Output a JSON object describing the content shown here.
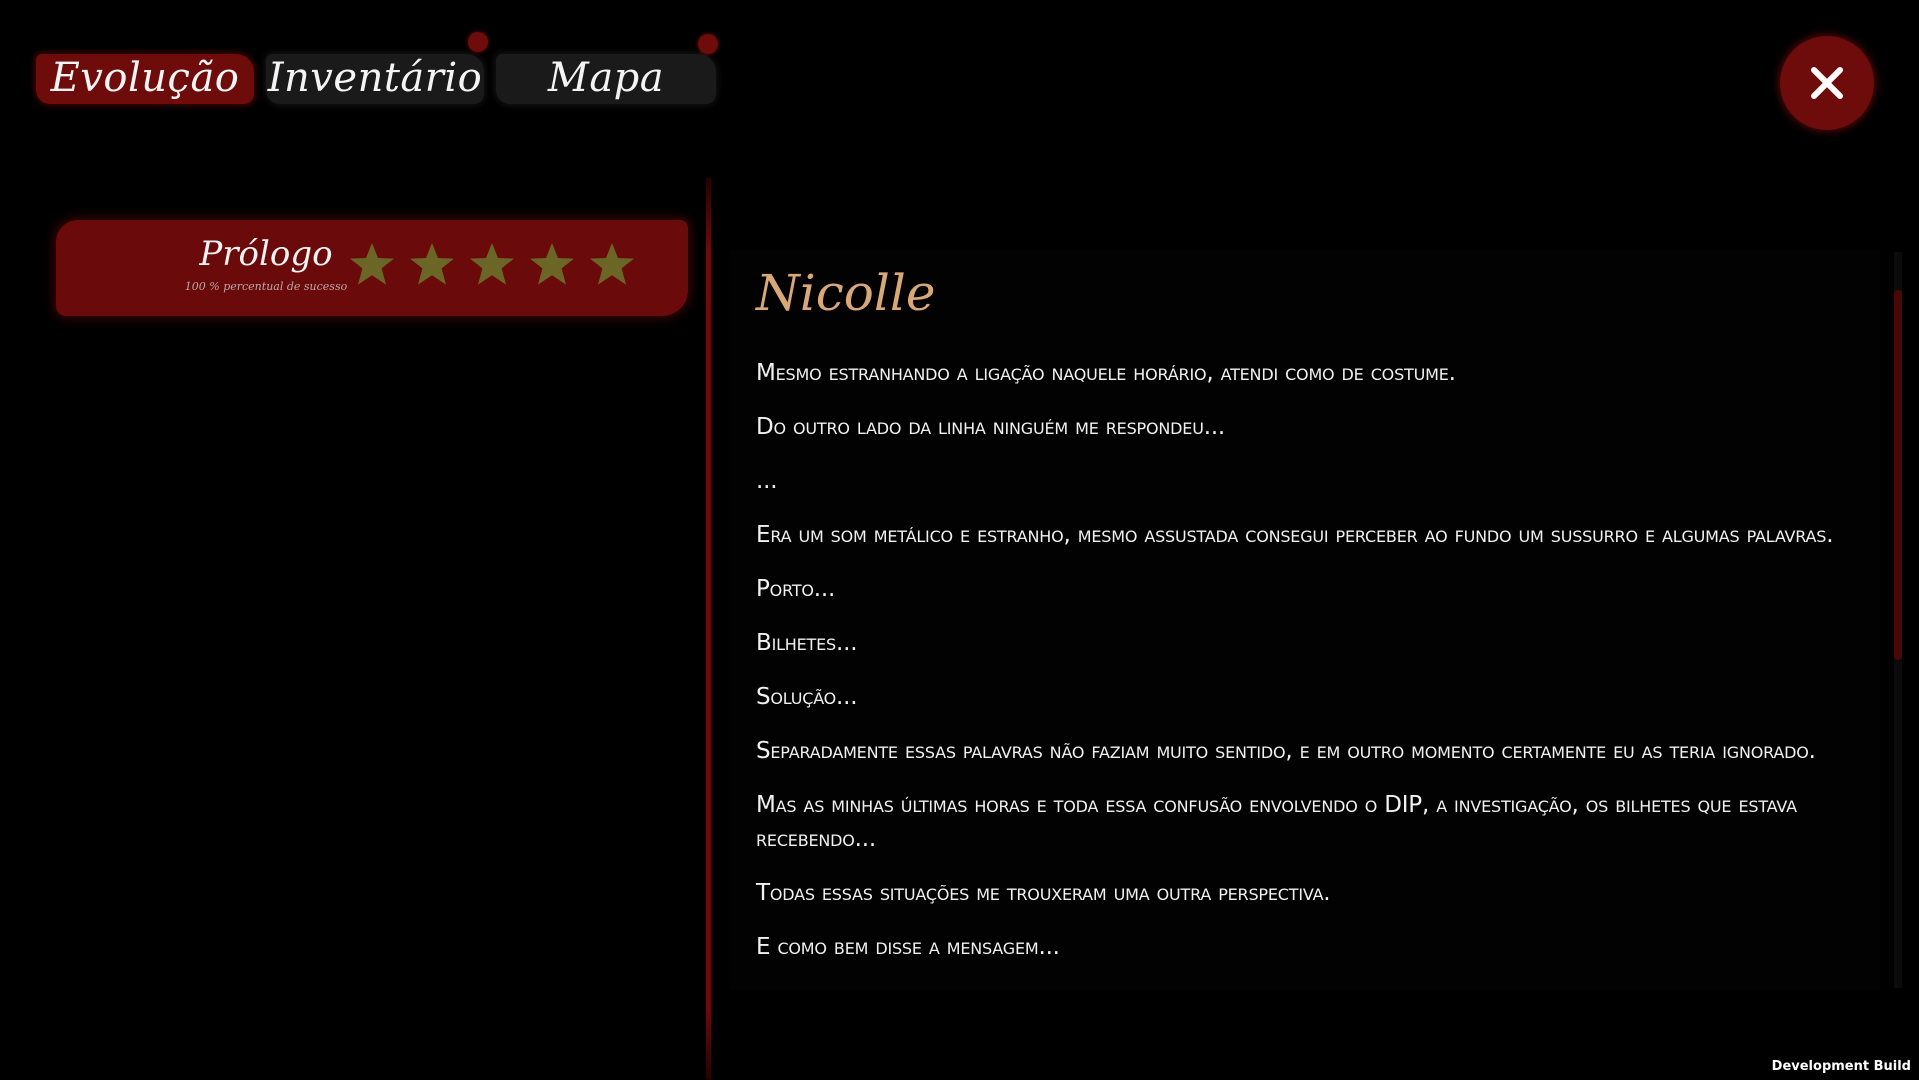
{
  "tabs": [
    {
      "label": "Evolução",
      "active": true,
      "has_notification": false
    },
    {
      "label": "Inventário",
      "active": false,
      "has_notification": true
    },
    {
      "label": "Mapa",
      "active": false,
      "has_notification": true
    }
  ],
  "close_icon": "close-icon",
  "chapter": {
    "title": "Prólogo",
    "subtitle": "100 % percentual de sucesso",
    "stars_filled": 5,
    "stars_total": 5,
    "star_color": "#6b6526"
  },
  "story": {
    "character_name": "Nicolle",
    "paragraphs": [
      "Mesmo estranhando a ligação naquele horário, atendi como de costume.",
      "Do outro lado da linha ninguém me respondeu...",
      "...",
      "Era um som metálico e estranho, mesmo assustada consegui perceber ao fundo um sussurro e algumas palavras.",
      "Porto...",
      "Bilhetes...",
      "Solução...",
      "Separadamente essas palavras não faziam muito sentido, e em outro momento certamente eu as teria ignorado.",
      "Mas as minhas últimas horas e toda essa confusão envolvendo o DIP, a investigação, os bilhetes que estava recebendo...",
      "Todas essas situações me trouxeram uma outra perspectiva.",
      "E como bem disse a mensagem..."
    ]
  },
  "footer": {
    "build_label": "Development Build"
  },
  "colors": {
    "accent_red": "#6e0b0b",
    "name_color": "#d8a878",
    "background": "#000000"
  }
}
